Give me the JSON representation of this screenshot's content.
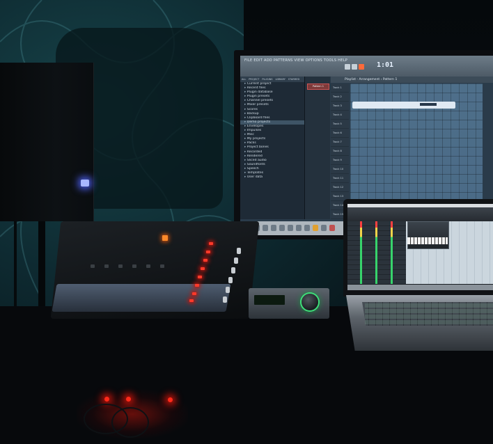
{
  "photo": {
    "subject": "home studio desk",
    "daw_monitor": {
      "time_display": "1:01",
      "browser_tabs": [
        "ALL",
        "PROJECT",
        "PLUGINS",
        "LIBRARY",
        "STARRED"
      ],
      "browser_items": [
        "Current project",
        "Recent files",
        "Plugin database",
        "Plugin presets",
        "Channel presets",
        "Mixer presets",
        "Scores",
        "Backup",
        "Clipboard files",
        "Demo projects",
        "Envelopes",
        "Impulses",
        "Misc",
        "My projects",
        "Packs",
        "Project bones",
        "Recorded",
        "Rendered",
        "Sliced audio",
        "Soundfonts",
        "Speech",
        "Templates",
        "User data"
      ],
      "playlist_title": "Playlist - Arrangement › Pattern 1",
      "channel_label": "Pattern 1",
      "tracks": [
        "Track 1",
        "Track 2",
        "Track 3",
        "Track 4",
        "Track 5",
        "Track 6",
        "Track 7",
        "Track 8",
        "Track 9",
        "Track 10",
        "Track 11",
        "Track 12",
        "Track 13",
        "Track 14",
        "Track 15"
      ]
    },
    "colors": {
      "wall_teal": "#17444a",
      "red_led": "#ff3a2a",
      "knob_ring": "#3fe07a",
      "speaker_led": "#a9b8ff"
    }
  }
}
